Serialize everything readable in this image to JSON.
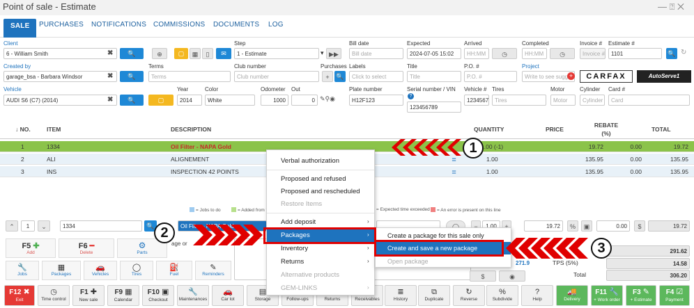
{
  "window": {
    "title": "Point of sale - Estimate",
    "controls": "— ⍰ ✕"
  },
  "tabs": [
    "SALE",
    "PURCHASES",
    "NOTIFICATIONS",
    "COMMISSIONS",
    "DOCUMENTS",
    "LOG"
  ],
  "form": {
    "client_label": "Client",
    "client_value": "6 - William Smith",
    "step_label": "Step",
    "step_value": "1 - Estimate",
    "bill_date_label": "Bill date",
    "bill_date_ph": "Bill date",
    "expected_label": "Expected",
    "expected_value": "2024-07-05 15:02",
    "arrived_label": "Arrived",
    "arrived_ph": "HH:MM",
    "completed_label": "Completed",
    "completed_ph": "HH:MM",
    "invoice_label": "Invoice #",
    "invoice_ph": "Invoice #",
    "estimate_label": "Estimate #",
    "estimate_value": "1101",
    "created_by_label": "Created by",
    "created_by_value": "garage_bsa - Barbara Windsor",
    "terms_label": "Terms",
    "terms_ph": "Terms",
    "club_label": "Club number",
    "club_ph": "Club number",
    "purchases_label": "Purchases",
    "labels_label": "Labels",
    "labels_ph": "Click to select",
    "title_label": "Title",
    "title_ph": "Title",
    "po_label": "P.O. #",
    "po_ph": "P.O. #",
    "project_label": "Project",
    "project_ph": "Write to see sugg",
    "carfax": "CARFAX",
    "autoserve": "AutoServe1",
    "vehicle_label": "Vehicle",
    "vehicle_value": "AUDI S6 (C7) (2014)",
    "year_label": "Year",
    "year_value": "2014",
    "color_label": "Color",
    "color_value": "White",
    "odometer_label": "Odometer",
    "odometer_value": "1000",
    "out_label": "Out",
    "out_value": "0",
    "plate_label": "Plate number",
    "plate_value": "H12F123",
    "serial_label": "Serial number / VIN",
    "serial_value": "123456789",
    "vehicle_no_label": "Vehicle #",
    "vehicle_no_value": "1234567",
    "tires_label": "Tires",
    "tires_ph": "Tires",
    "motor_label": "Motor",
    "motor_ph": "Motor",
    "cylinder_label": "Cylinder",
    "cylinder_ph": "Cylinder",
    "card_label": "Card #",
    "card_ph": "Card"
  },
  "table": {
    "headers": [
      "↓ NO.",
      "ITEM",
      "DESCRIPTION",
      "QUANTITY",
      "PRICE",
      "REBATE (%)",
      "TOTAL"
    ],
    "rows": [
      {
        "no": "1",
        "item": "1334",
        "desc": "Oil Filter - NAPA Gold",
        "qty": "1.00  (-1)",
        "price": "19.72",
        "rebate": "0.00",
        "total": "19.72"
      },
      {
        "no": "2",
        "item": "ALI",
        "desc": "ALIGNEMENT",
        "qty": "1.00",
        "price": "135.95",
        "rebate": "0.00",
        "total": "135.95"
      },
      {
        "no": "3",
        "item": "INS",
        "desc": "INSPECTION 42 POINTS",
        "qty": "1.00",
        "price": "135.95",
        "rebate": "0.00",
        "total": "135.95"
      }
    ]
  },
  "legend": {
    "jobs": "= Jobs to do",
    "added": "= Added from ti",
    "expected": "= Expected time exceeded",
    "error": "= An error is present on this line"
  },
  "editor": {
    "row_no": "1",
    "item": "1334",
    "desc": "Oil Filter - NAPA Gold",
    "qty": "1.00",
    "price": "19.72",
    "rebate": "0.00",
    "total": "19.72"
  },
  "context_menu": [
    "Verbal authorization",
    "Proposed and refused",
    "Proposed and rescheduled",
    "Restore Items",
    "Add deposit",
    "Packages",
    "Inventory",
    "Returns",
    "Alternative products",
    "GEM-LINKS"
  ],
  "submenu": [
    "Create a package for this sale only",
    "Create and save a new package",
    "Open package"
  ],
  "callouts": [
    "1",
    "2",
    "3"
  ],
  "quick_cards": {
    "f5": "F5",
    "f5_label": "Add",
    "f6": "F6",
    "f6_label": "Delete",
    "parts": "Parts",
    "jobs": "Jobs",
    "packages": "Packages",
    "vehicles": "Vehicles",
    "tires": "Tires",
    "fuel": "Fuel",
    "reminders": "Reminders",
    "note": "age or"
  },
  "totals": {
    "subtotal": "291.62",
    "tps_label": "TPS (5%)",
    "tps": "14.58",
    "total_label": "Total",
    "total": "306.20",
    "partial": "271.9"
  },
  "toolbar": [
    {
      "key": "F12",
      "label": "Exit"
    },
    {
      "key": "",
      "label": "Time control"
    },
    {
      "key": "F1",
      "label": "New sale"
    },
    {
      "key": "F9",
      "label": "Calendar"
    },
    {
      "key": "F10",
      "label": "Checkout"
    },
    {
      "key": "",
      "label": "Maintenances"
    },
    {
      "key": "",
      "label": "Car lot"
    },
    {
      "key": "",
      "label": "Storage"
    },
    {
      "key": "",
      "label": "Follow-ups"
    },
    {
      "key": "",
      "label": "Returns"
    },
    {
      "key": "",
      "label": "Receivables"
    },
    {
      "key": "",
      "label": "History"
    },
    {
      "key": "",
      "label": "Duplicate"
    },
    {
      "key": "",
      "label": "Reverse"
    },
    {
      "key": "",
      "label": "Subdivide"
    },
    {
      "key": "",
      "label": "Help"
    },
    {
      "key": "",
      "label": "Delivery"
    },
    {
      "key": "F11",
      "label": "+ Work order"
    },
    {
      "key": "F3",
      "label": "+ Estimate"
    },
    {
      "key": "F4",
      "label": "Payment"
    }
  ]
}
